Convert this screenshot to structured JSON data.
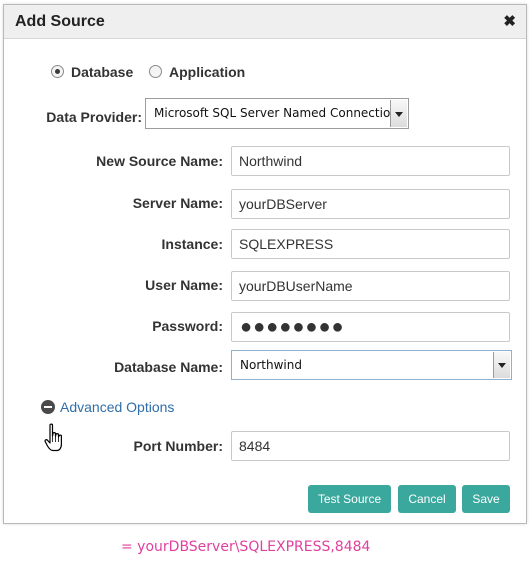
{
  "dialog": {
    "title": "Add Source",
    "close_glyph": "✖"
  },
  "source_type": {
    "options": [
      {
        "label": "Database",
        "selected": true
      },
      {
        "label": "Application",
        "selected": false
      }
    ]
  },
  "data_provider": {
    "label": "Data Provider:",
    "value": "Microsoft SQL Server Named Connection"
  },
  "fields": {
    "new_source_name": {
      "label": "New Source Name:",
      "value": "Northwind"
    },
    "server_name": {
      "label": "Server Name:",
      "value": "yourDBServer"
    },
    "instance": {
      "label": "Instance:",
      "value": "SQLEXPRESS"
    },
    "user_name": {
      "label": "User Name:",
      "value": "yourDBUserName"
    },
    "password": {
      "label": "Password:",
      "value": "●●●●●●●●"
    },
    "database_name": {
      "label": "Database Name:",
      "value": "Northwind"
    },
    "port_number": {
      "label": "Port Number:",
      "value": "8484"
    }
  },
  "advanced": {
    "label": "Advanced Options",
    "icon": "minus-circle-icon"
  },
  "buttons": {
    "test_source": "Test Source",
    "cancel": "Cancel",
    "save": "Save"
  },
  "footer_note": "= yourDBServer\\SQLEXPRESS,8484",
  "colors": {
    "accent": "#3aa89d",
    "link": "#2f6ea8",
    "note": "#e0409f"
  }
}
